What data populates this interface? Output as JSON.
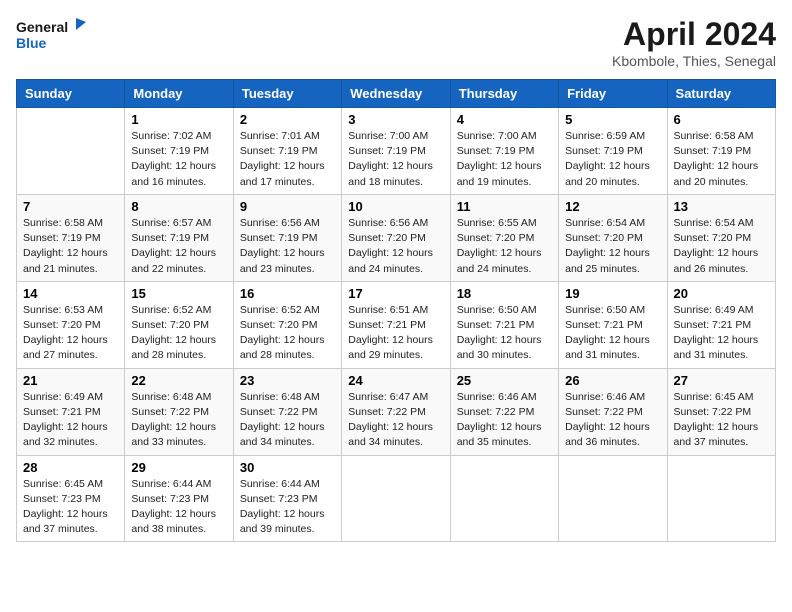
{
  "header": {
    "logo_line1": "General",
    "logo_line2": "Blue",
    "month_title": "April 2024",
    "location": "Kbombole, Thies, Senegal"
  },
  "columns": [
    "Sunday",
    "Monday",
    "Tuesday",
    "Wednesday",
    "Thursday",
    "Friday",
    "Saturday"
  ],
  "weeks": [
    [
      {
        "day": "",
        "info": ""
      },
      {
        "day": "1",
        "info": "Sunrise: 7:02 AM\nSunset: 7:19 PM\nDaylight: 12 hours\nand 16 minutes."
      },
      {
        "day": "2",
        "info": "Sunrise: 7:01 AM\nSunset: 7:19 PM\nDaylight: 12 hours\nand 17 minutes."
      },
      {
        "day": "3",
        "info": "Sunrise: 7:00 AM\nSunset: 7:19 PM\nDaylight: 12 hours\nand 18 minutes."
      },
      {
        "day": "4",
        "info": "Sunrise: 7:00 AM\nSunset: 7:19 PM\nDaylight: 12 hours\nand 19 minutes."
      },
      {
        "day": "5",
        "info": "Sunrise: 6:59 AM\nSunset: 7:19 PM\nDaylight: 12 hours\nand 20 minutes."
      },
      {
        "day": "6",
        "info": "Sunrise: 6:58 AM\nSunset: 7:19 PM\nDaylight: 12 hours\nand 20 minutes."
      }
    ],
    [
      {
        "day": "7",
        "info": "Sunrise: 6:58 AM\nSunset: 7:19 PM\nDaylight: 12 hours\nand 21 minutes."
      },
      {
        "day": "8",
        "info": "Sunrise: 6:57 AM\nSunset: 7:19 PM\nDaylight: 12 hours\nand 22 minutes."
      },
      {
        "day": "9",
        "info": "Sunrise: 6:56 AM\nSunset: 7:19 PM\nDaylight: 12 hours\nand 23 minutes."
      },
      {
        "day": "10",
        "info": "Sunrise: 6:56 AM\nSunset: 7:20 PM\nDaylight: 12 hours\nand 24 minutes."
      },
      {
        "day": "11",
        "info": "Sunrise: 6:55 AM\nSunset: 7:20 PM\nDaylight: 12 hours\nand 24 minutes."
      },
      {
        "day": "12",
        "info": "Sunrise: 6:54 AM\nSunset: 7:20 PM\nDaylight: 12 hours\nand 25 minutes."
      },
      {
        "day": "13",
        "info": "Sunrise: 6:54 AM\nSunset: 7:20 PM\nDaylight: 12 hours\nand 26 minutes."
      }
    ],
    [
      {
        "day": "14",
        "info": "Sunrise: 6:53 AM\nSunset: 7:20 PM\nDaylight: 12 hours\nand 27 minutes."
      },
      {
        "day": "15",
        "info": "Sunrise: 6:52 AM\nSunset: 7:20 PM\nDaylight: 12 hours\nand 28 minutes."
      },
      {
        "day": "16",
        "info": "Sunrise: 6:52 AM\nSunset: 7:20 PM\nDaylight: 12 hours\nand 28 minutes."
      },
      {
        "day": "17",
        "info": "Sunrise: 6:51 AM\nSunset: 7:21 PM\nDaylight: 12 hours\nand 29 minutes."
      },
      {
        "day": "18",
        "info": "Sunrise: 6:50 AM\nSunset: 7:21 PM\nDaylight: 12 hours\nand 30 minutes."
      },
      {
        "day": "19",
        "info": "Sunrise: 6:50 AM\nSunset: 7:21 PM\nDaylight: 12 hours\nand 31 minutes."
      },
      {
        "day": "20",
        "info": "Sunrise: 6:49 AM\nSunset: 7:21 PM\nDaylight: 12 hours\nand 31 minutes."
      }
    ],
    [
      {
        "day": "21",
        "info": "Sunrise: 6:49 AM\nSunset: 7:21 PM\nDaylight: 12 hours\nand 32 minutes."
      },
      {
        "day": "22",
        "info": "Sunrise: 6:48 AM\nSunset: 7:22 PM\nDaylight: 12 hours\nand 33 minutes."
      },
      {
        "day": "23",
        "info": "Sunrise: 6:48 AM\nSunset: 7:22 PM\nDaylight: 12 hours\nand 34 minutes."
      },
      {
        "day": "24",
        "info": "Sunrise: 6:47 AM\nSunset: 7:22 PM\nDaylight: 12 hours\nand 34 minutes."
      },
      {
        "day": "25",
        "info": "Sunrise: 6:46 AM\nSunset: 7:22 PM\nDaylight: 12 hours\nand 35 minutes."
      },
      {
        "day": "26",
        "info": "Sunrise: 6:46 AM\nSunset: 7:22 PM\nDaylight: 12 hours\nand 36 minutes."
      },
      {
        "day": "27",
        "info": "Sunrise: 6:45 AM\nSunset: 7:22 PM\nDaylight: 12 hours\nand 37 minutes."
      }
    ],
    [
      {
        "day": "28",
        "info": "Sunrise: 6:45 AM\nSunset: 7:23 PM\nDaylight: 12 hours\nand 37 minutes."
      },
      {
        "day": "29",
        "info": "Sunrise: 6:44 AM\nSunset: 7:23 PM\nDaylight: 12 hours\nand 38 minutes."
      },
      {
        "day": "30",
        "info": "Sunrise: 6:44 AM\nSunset: 7:23 PM\nDaylight: 12 hours\nand 39 minutes."
      },
      {
        "day": "",
        "info": ""
      },
      {
        "day": "",
        "info": ""
      },
      {
        "day": "",
        "info": ""
      },
      {
        "day": "",
        "info": ""
      }
    ]
  ]
}
